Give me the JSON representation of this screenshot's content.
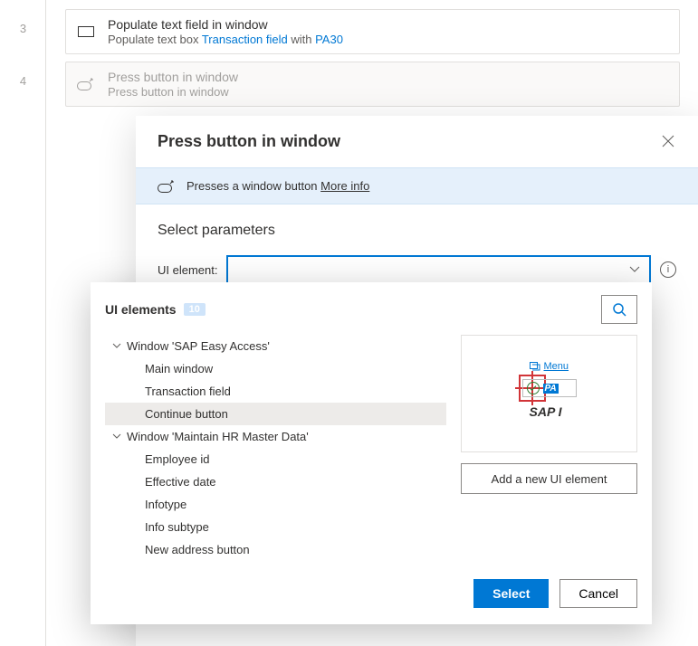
{
  "steps": [
    {
      "num": "3",
      "title": "Populate text field in window",
      "sub_prefix": "Populate text box ",
      "sub_link1": "Transaction field",
      "sub_mid": " with ",
      "sub_link2": "PA30"
    },
    {
      "num": "4",
      "title": "Press button in window",
      "sub": "Press button in window"
    }
  ],
  "dialog": {
    "title": "Press button in window",
    "info_text": "Presses a window button ",
    "more_info": "More info",
    "section_title": "Select parameters",
    "param_label": "UI element:"
  },
  "picker": {
    "title_label": "UI elements",
    "count": "10",
    "groups": [
      {
        "name": "Window 'SAP Easy Access'",
        "children": [
          "Main window",
          "Transaction field",
          "Continue button"
        ],
        "selected_index": 2
      },
      {
        "name": "Window 'Maintain HR Master Data'",
        "children": [
          "Employee id",
          "Effective date",
          "Infotype",
          "Info subtype",
          "New address button"
        ],
        "selected_index": -1
      }
    ],
    "preview": {
      "menu_label": "Menu",
      "pa_chip": "PA",
      "sap_label": "SAP I"
    },
    "add_button": "Add a new UI element",
    "select_button": "Select",
    "cancel_button": "Cancel"
  }
}
